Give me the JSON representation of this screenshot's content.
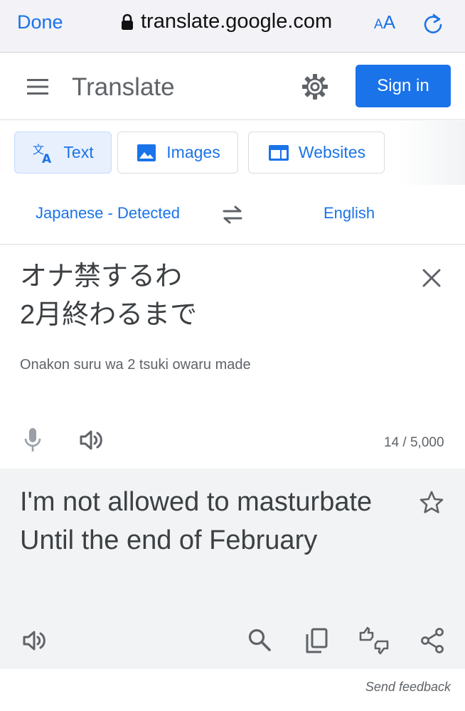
{
  "browser": {
    "done_label": "Done",
    "url": "translate.google.com",
    "text_size_label_small": "A",
    "text_size_label_large": "A",
    "icons": [
      "lock-icon",
      "reload-icon"
    ]
  },
  "header": {
    "title": "Translate",
    "sign_in_label": "Sign in",
    "icons": [
      "menu-icon",
      "gear-icon"
    ]
  },
  "tabs": [
    {
      "label": "Text",
      "icon": "translate-icon",
      "active": true
    },
    {
      "label": "Images",
      "icon": "image-icon",
      "active": false
    },
    {
      "label": "Websites",
      "icon": "website-icon",
      "active": false
    }
  ],
  "languages": {
    "source": "Japanese - Detected",
    "target": "English"
  },
  "source": {
    "text": "オナ禁するわ\n2月終わるまで",
    "romanization": "Onakon suru wa 2 tsuki owaru made",
    "char_count": "14 / 5,000"
  },
  "result": {
    "text": "I'm not allowed to masturbate\nUntil the end of February"
  },
  "footer": {
    "feedback_label": "Send feedback"
  },
  "colors": {
    "accent": "#1a73e8",
    "result_bg": "#f1f3f4",
    "active_tab_bg": "#e8f0fe"
  }
}
